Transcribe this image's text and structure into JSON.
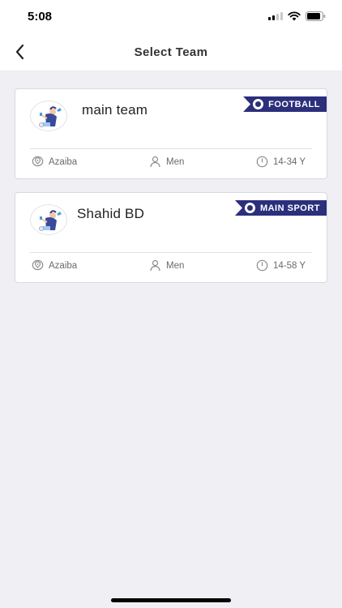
{
  "status_bar": {
    "time": "5:08"
  },
  "header": {
    "title": "Select Team"
  },
  "teams": [
    {
      "name": "main team",
      "badge": "FOOTBALL",
      "location": "Azaiba",
      "gender": "Men",
      "age": "14-34 Y"
    },
    {
      "name": "Shahid BD",
      "badge": "MAIN SPORT",
      "location": "Azaiba",
      "gender": "Men",
      "age": "14-58 Y"
    }
  ],
  "colors": {
    "accent": "#2b2f7c",
    "background": "#efeff4"
  }
}
